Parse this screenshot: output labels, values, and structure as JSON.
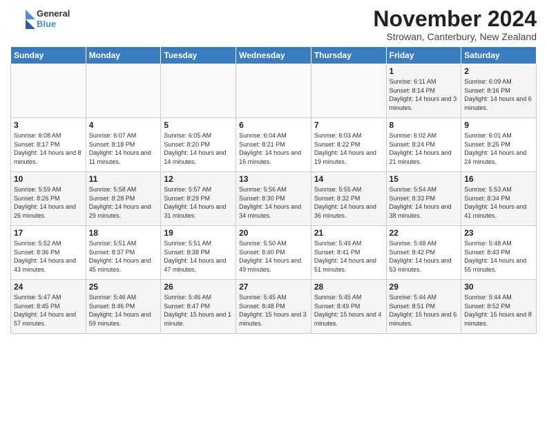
{
  "header": {
    "logo_general": "General",
    "logo_blue": "Blue",
    "month_title": "November 2024",
    "subtitle": "Strowan, Canterbury, New Zealand"
  },
  "weekdays": [
    "Sunday",
    "Monday",
    "Tuesday",
    "Wednesday",
    "Thursday",
    "Friday",
    "Saturday"
  ],
  "weeks": [
    [
      {
        "day": "",
        "info": ""
      },
      {
        "day": "",
        "info": ""
      },
      {
        "day": "",
        "info": ""
      },
      {
        "day": "",
        "info": ""
      },
      {
        "day": "",
        "info": ""
      },
      {
        "day": "1",
        "info": "Sunrise: 6:11 AM\nSunset: 8:14 PM\nDaylight: 14 hours and 3 minutes."
      },
      {
        "day": "2",
        "info": "Sunrise: 6:09 AM\nSunset: 8:16 PM\nDaylight: 14 hours and 6 minutes."
      }
    ],
    [
      {
        "day": "3",
        "info": "Sunrise: 6:08 AM\nSunset: 8:17 PM\nDaylight: 14 hours and 8 minutes."
      },
      {
        "day": "4",
        "info": "Sunrise: 6:07 AM\nSunset: 8:18 PM\nDaylight: 14 hours and 11 minutes."
      },
      {
        "day": "5",
        "info": "Sunrise: 6:05 AM\nSunset: 8:20 PM\nDaylight: 14 hours and 14 minutes."
      },
      {
        "day": "6",
        "info": "Sunrise: 6:04 AM\nSunset: 8:21 PM\nDaylight: 14 hours and 16 minutes."
      },
      {
        "day": "7",
        "info": "Sunrise: 6:03 AM\nSunset: 8:22 PM\nDaylight: 14 hours and 19 minutes."
      },
      {
        "day": "8",
        "info": "Sunrise: 6:02 AM\nSunset: 8:24 PM\nDaylight: 14 hours and 21 minutes."
      },
      {
        "day": "9",
        "info": "Sunrise: 6:01 AM\nSunset: 8:25 PM\nDaylight: 14 hours and 24 minutes."
      }
    ],
    [
      {
        "day": "10",
        "info": "Sunrise: 5:59 AM\nSunset: 8:26 PM\nDaylight: 14 hours and 26 minutes."
      },
      {
        "day": "11",
        "info": "Sunrise: 5:58 AM\nSunset: 8:28 PM\nDaylight: 14 hours and 29 minutes."
      },
      {
        "day": "12",
        "info": "Sunrise: 5:57 AM\nSunset: 8:29 PM\nDaylight: 14 hours and 31 minutes."
      },
      {
        "day": "13",
        "info": "Sunrise: 5:56 AM\nSunset: 8:30 PM\nDaylight: 14 hours and 34 minutes."
      },
      {
        "day": "14",
        "info": "Sunrise: 5:55 AM\nSunset: 8:32 PM\nDaylight: 14 hours and 36 minutes."
      },
      {
        "day": "15",
        "info": "Sunrise: 5:54 AM\nSunset: 8:33 PM\nDaylight: 14 hours and 38 minutes."
      },
      {
        "day": "16",
        "info": "Sunrise: 5:53 AM\nSunset: 8:34 PM\nDaylight: 14 hours and 41 minutes."
      }
    ],
    [
      {
        "day": "17",
        "info": "Sunrise: 5:52 AM\nSunset: 8:36 PM\nDaylight: 14 hours and 43 minutes."
      },
      {
        "day": "18",
        "info": "Sunrise: 5:51 AM\nSunset: 8:37 PM\nDaylight: 14 hours and 45 minutes."
      },
      {
        "day": "19",
        "info": "Sunrise: 5:51 AM\nSunset: 8:38 PM\nDaylight: 14 hours and 47 minutes."
      },
      {
        "day": "20",
        "info": "Sunrise: 5:50 AM\nSunset: 8:40 PM\nDaylight: 14 hours and 49 minutes."
      },
      {
        "day": "21",
        "info": "Sunrise: 5:49 AM\nSunset: 8:41 PM\nDaylight: 14 hours and 51 minutes."
      },
      {
        "day": "22",
        "info": "Sunrise: 5:48 AM\nSunset: 8:42 PM\nDaylight: 14 hours and 53 minutes."
      },
      {
        "day": "23",
        "info": "Sunrise: 5:48 AM\nSunset: 8:43 PM\nDaylight: 14 hours and 55 minutes."
      }
    ],
    [
      {
        "day": "24",
        "info": "Sunrise: 5:47 AM\nSunset: 8:45 PM\nDaylight: 14 hours and 57 minutes."
      },
      {
        "day": "25",
        "info": "Sunrise: 5:46 AM\nSunset: 8:46 PM\nDaylight: 14 hours and 59 minutes."
      },
      {
        "day": "26",
        "info": "Sunrise: 5:46 AM\nSunset: 8:47 PM\nDaylight: 15 hours and 1 minute."
      },
      {
        "day": "27",
        "info": "Sunrise: 5:45 AM\nSunset: 8:48 PM\nDaylight: 15 hours and 3 minutes."
      },
      {
        "day": "28",
        "info": "Sunrise: 5:45 AM\nSunset: 8:49 PM\nDaylight: 15 hours and 4 minutes."
      },
      {
        "day": "29",
        "info": "Sunrise: 5:44 AM\nSunset: 8:51 PM\nDaylight: 15 hours and 6 minutes."
      },
      {
        "day": "30",
        "info": "Sunrise: 5:44 AM\nSunset: 8:52 PM\nDaylight: 15 hours and 8 minutes."
      }
    ]
  ]
}
